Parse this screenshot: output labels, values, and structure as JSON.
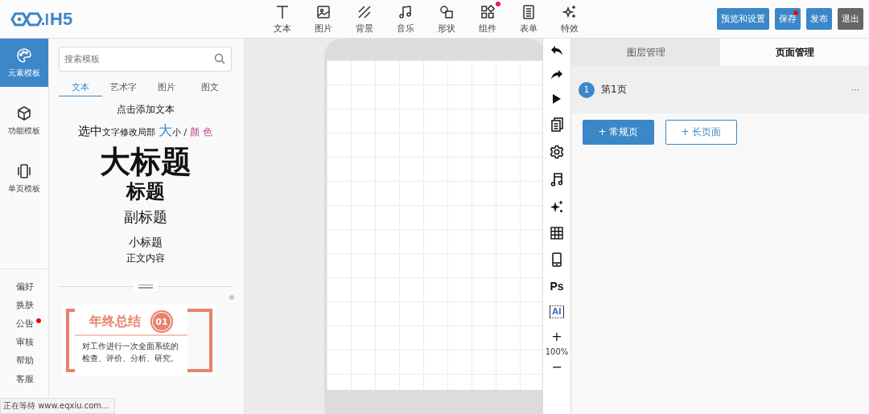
{
  "logo": {
    "text": "H5"
  },
  "toolbar": [
    {
      "label": "文本",
      "badge": false
    },
    {
      "label": "图片",
      "badge": false
    },
    {
      "label": "背景",
      "badge": false
    },
    {
      "label": "音乐",
      "badge": false
    },
    {
      "label": "形状",
      "badge": false
    },
    {
      "label": "组件",
      "badge": true
    },
    {
      "label": "表单",
      "badge": false
    },
    {
      "label": "特效",
      "badge": false
    }
  ],
  "actions": [
    {
      "label": "预览和设置",
      "kind": "primary",
      "badge": false
    },
    {
      "label": "保存",
      "kind": "primary",
      "badge": true
    },
    {
      "label": "发布",
      "kind": "primary",
      "badge": false
    },
    {
      "label": "退出",
      "kind": "dark",
      "badge": false
    }
  ],
  "rail": {
    "items": [
      {
        "label": "元素模板",
        "selected": true
      },
      {
        "label": "功能模板",
        "selected": false
      },
      {
        "label": "单页模板",
        "selected": false
      }
    ],
    "links": [
      {
        "label": "偏好",
        "badge": false
      },
      {
        "label": "换肤",
        "badge": false
      },
      {
        "label": "公告",
        "badge": true
      },
      {
        "label": "审核",
        "badge": false
      },
      {
        "label": "帮助",
        "badge": false
      },
      {
        "label": "客服",
        "badge": false
      }
    ]
  },
  "panel": {
    "search": {
      "placeholder": "搜索模板"
    },
    "tabs": [
      {
        "label": "文本",
        "selected": true
      },
      {
        "label": "艺术字",
        "selected": false
      },
      {
        "label": "图片",
        "selected": false
      },
      {
        "label": "图文",
        "selected": false
      }
    ],
    "hint": "点击添加文本",
    "styled_sample": [
      {
        "text": "选中",
        "kind": "large"
      },
      {
        "text": "文字修改局部 ",
        "kind": "small"
      },
      {
        "text": "大",
        "kind": "blue"
      },
      {
        "text": "小 / ",
        "kind": "small"
      },
      {
        "text": "颜 色",
        "kind": "pink"
      }
    ],
    "samples": [
      {
        "text": "大标题",
        "kind": "h1"
      },
      {
        "text": "标题",
        "kind": "h2"
      },
      {
        "text": "副标题",
        "kind": "h3"
      },
      {
        "text": "小标题",
        "kind": "h4"
      },
      {
        "text": "正文内容",
        "kind": "body"
      }
    ],
    "template": {
      "title": "年终总结",
      "number": "01",
      "body": "对工作进行一次全面系统的检查、评价、分析、研究。"
    }
  },
  "tools": {
    "ps": "Ps",
    "ai": "AI",
    "zoom_in": "+",
    "zoom": "100%",
    "zoom_out": "−"
  },
  "right": {
    "tabs": [
      {
        "label": "图层管理",
        "selected": false
      },
      {
        "label": "页面管理",
        "selected": true
      }
    ],
    "pages": [
      {
        "number": "1",
        "name": "第1页",
        "more": "···"
      }
    ],
    "buttons": [
      {
        "label": "+ 常规页",
        "kind": "primary"
      },
      {
        "label": "+ 长页面",
        "kind": "outline"
      }
    ]
  },
  "status": "正在等待 www.eqxiu.com..."
}
